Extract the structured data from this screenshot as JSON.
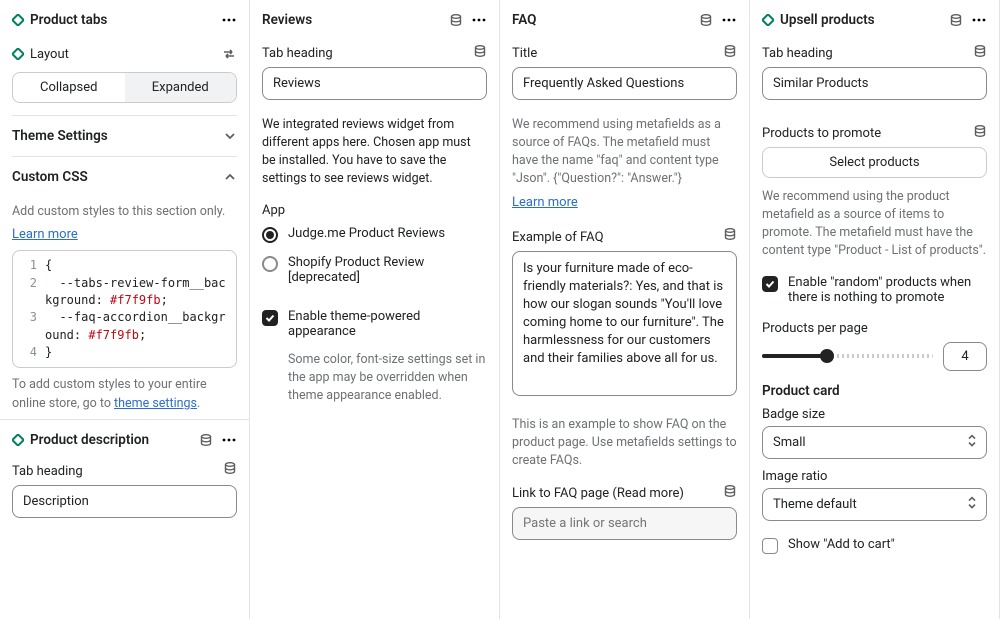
{
  "col1": {
    "ptabs_title": "Product tabs",
    "layout_label": "Layout",
    "seg_collapsed": "Collapsed",
    "seg_expanded": "Expanded",
    "theme_settings": "Theme Settings",
    "custom_css": "Custom CSS",
    "css_help": "Add custom styles to this section only.",
    "learn_more": "Learn more",
    "code_l1": "{",
    "code_l2a": "  --tabs-review-form__background: ",
    "code_l2b": "#f7f9fb",
    "code_l2c": ";",
    "code_l3a": "  --faq-accordion__background: ",
    "code_l3b": "#f7f9fb",
    "code_l3c": ";",
    "code_l4": "}",
    "css_footer_a": "To add custom styles to your entire online store, go to ",
    "css_footer_link": "theme settings",
    "css_footer_b": ".",
    "pdesc_title": "Product description",
    "tab_heading_label": "Tab heading",
    "tab_heading_value": "Description"
  },
  "col2": {
    "title": "Reviews",
    "tab_heading_label": "Tab heading",
    "tab_heading_value": "Reviews",
    "desc": "We integrated reviews widget from different apps here. Chosen app must be installed. You have to save the settings to see reviews widget.",
    "app_label": "App",
    "radio1": "Judge.me Product Reviews",
    "radio2": "Shopify Product Review [deprecated]",
    "check_label": "Enable theme-powered appearance",
    "check_help": "Some color, font-size settings set in the app may be overridden when theme appearance enabled."
  },
  "col3": {
    "title": "FAQ",
    "title_label": "Title",
    "title_value": "Frequently Asked Questions",
    "help": "We recommend using metafields as a source of FAQs. The metafield must have the name \"faq\" and content type \"Json\". {\"Question?\": \"Answer.\"}",
    "learn_more": "Learn more",
    "example_label": "Example of FAQ",
    "example_value": "Is your furniture made of eco-friendly materials?: Yes, and that is how our slogan sounds \"You'll love coming home to our furniture\". The harmlessness for our customers and their families above all for us.",
    "example_help": "This is an example to show FAQ on the product page. Use metafields settings to create FAQs.",
    "link_label": "Link to FAQ page (Read more)",
    "link_placeholder": "Paste a link or search"
  },
  "col4": {
    "title": "Upsell products",
    "tab_heading_label": "Tab heading",
    "tab_heading_value": "Similar Products",
    "promote_label": "Products to promote",
    "select_btn": "Select products",
    "promote_help": "We recommend using the product metafield as a source of items to promote. The metafield must have the content type \"Product - List of products\".",
    "random_label": "Enable \"random\" products when there is nothing to promote",
    "ppp_label": "Products per page",
    "ppp_value": "4",
    "card_heading": "Product card",
    "badge_label": "Badge size",
    "badge_value": "Small",
    "ratio_label": "Image ratio",
    "ratio_value": "Theme default",
    "show_cart": "Show \"Add to cart\""
  }
}
